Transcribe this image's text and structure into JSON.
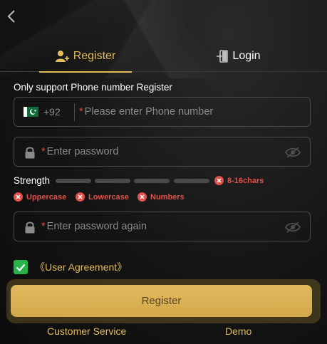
{
  "tabs": {
    "register_label": "Register",
    "login_label": "Login"
  },
  "hint": "Only support Phone number Register",
  "phone": {
    "country_code": "+92",
    "required_mark": "*",
    "placeholder": "Please enter Phone number"
  },
  "password": {
    "required_mark": "*",
    "placeholder": "Enter password"
  },
  "strength": {
    "label": "Strength",
    "level": 0,
    "rules": [
      "8-16chars",
      "Uppercase",
      "Lowercase",
      "Numbers"
    ]
  },
  "password_again": {
    "required_mark": "*",
    "placeholder": "Enter password again"
  },
  "agreement": {
    "checked": true,
    "label": "《User Agreement》"
  },
  "register_button": "Register",
  "footer": {
    "customer_service": "Customer Service",
    "demo": "Demo"
  },
  "colors": {
    "accent": "#e5bb5b",
    "error": "#e0504a",
    "checkbox": "#27b24c",
    "button": "#d8ae50"
  },
  "icons": [
    "back-arrow-icon",
    "user-add-icon",
    "login-door-icon",
    "pakistan-flag-icon",
    "lock-icon",
    "eye-off-icon",
    "x-circle-icon",
    "checkmark-icon"
  ]
}
